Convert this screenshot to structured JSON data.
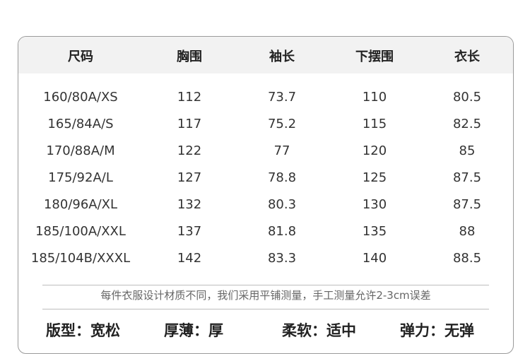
{
  "table": {
    "headers": [
      "尺码",
      "胸围",
      "袖长",
      "下摆围",
      "衣长"
    ],
    "rows": [
      [
        "160/80A/XS",
        "112",
        "73.7",
        "110",
        "80.5"
      ],
      [
        "165/84A/S",
        "117",
        "75.2",
        "115",
        "82.5"
      ],
      [
        "170/88A/M",
        "122",
        "77",
        "120",
        "85"
      ],
      [
        "175/92A/L",
        "127",
        "78.8",
        "125",
        "87.5"
      ],
      [
        "180/96A/XL",
        "132",
        "80.3",
        "130",
        "87.5"
      ],
      [
        "185/100A/XXL",
        "137",
        "81.8",
        "135",
        "88"
      ],
      [
        "185/104B/XXXL",
        "142",
        "83.3",
        "140",
        "88.5"
      ]
    ]
  },
  "note": "每件衣服设计材质不同，我们采用平铺测量，手工测量允许2-3cm误差",
  "attributes": {
    "fit": "版型：宽松",
    "thickness": "厚薄：厚",
    "softness": "柔软：适中",
    "elasticity": "弹力：无弹"
  }
}
